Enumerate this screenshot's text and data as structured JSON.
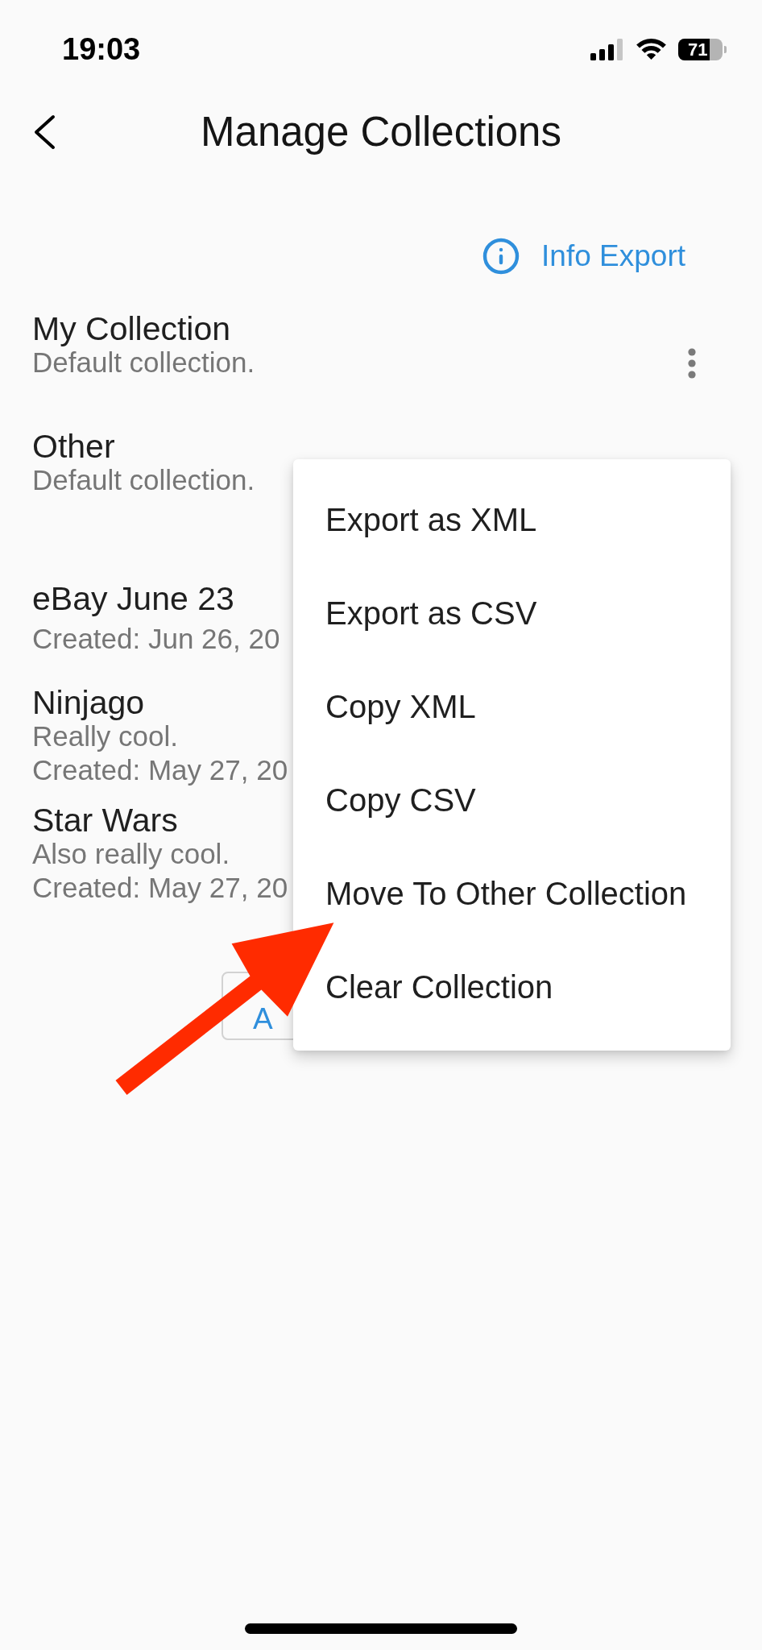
{
  "status_bar": {
    "time": "19:03",
    "battery": "71"
  },
  "header": {
    "title": "Manage Collections"
  },
  "info_button": {
    "label": "Info Export"
  },
  "default_collections": [
    {
      "title": "My Collection",
      "description": "Default collection.",
      "more_button": true
    },
    {
      "title": "Other",
      "description": "Default collection."
    }
  ],
  "collections": [
    {
      "title": "eBay June 23",
      "created": "Created: Jun 26, 20"
    },
    {
      "title": "Ninjago",
      "description": "Really cool.",
      "created": "Created: May 27, 20"
    },
    {
      "title": "Star Wars",
      "description": "Also really cool.",
      "created": "Created: May 27, 20"
    }
  ],
  "add_button": {
    "label": "A"
  },
  "menu": {
    "items": [
      "Export as XML",
      "Export as CSV",
      "Copy XML",
      "Copy CSV",
      "Move To Other Collection",
      "Clear Collection"
    ]
  },
  "annotation": {
    "kind": "arrow"
  }
}
